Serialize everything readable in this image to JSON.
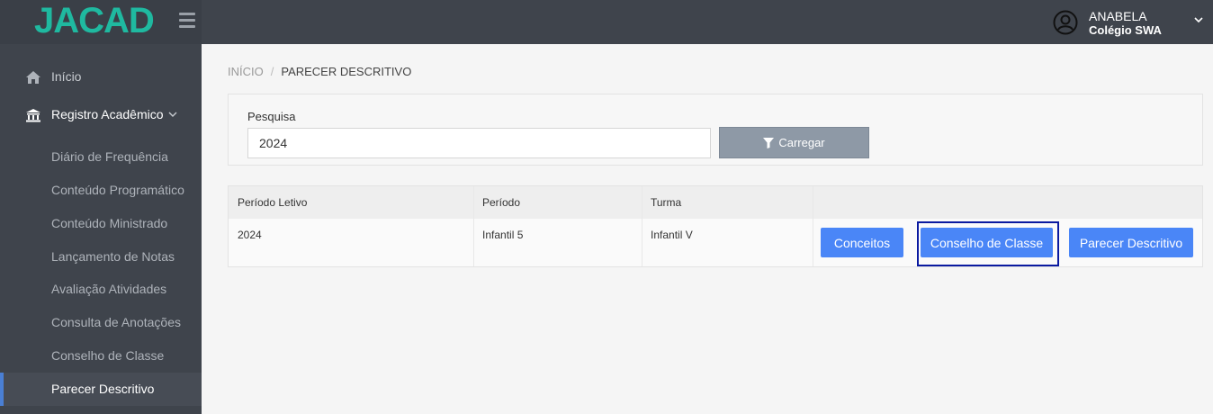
{
  "brand": {
    "logo": "JACAD"
  },
  "header": {
    "user_name": "ANABELA",
    "school": "Colégio SWA"
  },
  "sidebar": {
    "items": [
      {
        "label": "Início",
        "icon": "home-icon"
      },
      {
        "label": "Registro Acadêmico",
        "icon": "institution-icon",
        "expanded": true
      }
    ],
    "subitems": [
      {
        "label": "Diário de Frequência"
      },
      {
        "label": "Conteúdo Programático"
      },
      {
        "label": "Conteúdo Ministrado"
      },
      {
        "label": "Lançamento de Notas"
      },
      {
        "label": "Avaliação Atividades"
      },
      {
        "label": "Consulta de Anotações"
      },
      {
        "label": "Conselho de Classe"
      },
      {
        "label": "Parecer Descritivo",
        "active": true
      }
    ]
  },
  "breadcrumb": {
    "home": "INÍCIO",
    "separator": "/",
    "current": "PARECER DESCRITIVO"
  },
  "search": {
    "label": "Pesquisa",
    "value": "2024",
    "button": "Carregar"
  },
  "table": {
    "headers": [
      "Período Letivo",
      "Período",
      "Turma"
    ],
    "rows": [
      {
        "periodo_letivo": "2024",
        "periodo": "Infantil 5",
        "turma": "Infantil V"
      }
    ],
    "actions": [
      "Conceitos",
      "Conselho de Classe",
      "Parecer Descritivo"
    ]
  },
  "colors": {
    "accent": "#4a86f7",
    "logo": "#1fb9a0",
    "sidebar": "#3f444c",
    "focus": "#0a1aa0"
  }
}
